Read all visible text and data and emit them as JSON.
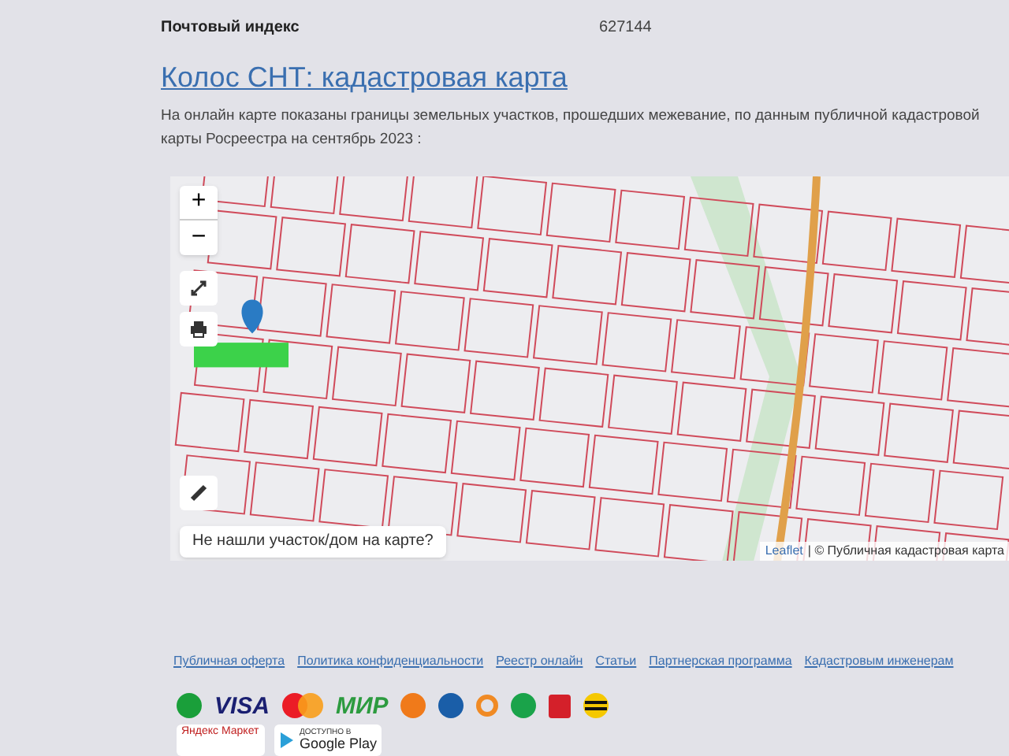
{
  "info_row": {
    "label": "Почтовый индекс",
    "value": "627144"
  },
  "title": "Колос СНТ: кадастровая карта",
  "description": "На онлайн карте показаны границы земельных участков, прошедших межевание, по данным публичной кадастровой карты Росреестра на сентябрь 2023 :",
  "map": {
    "zoom_in": "+",
    "zoom_out": "−",
    "hint": "Не нашли участок/дом на карте?",
    "attribution_link": "Leaflet",
    "attribution": "| © Публичная кадастровая карта"
  },
  "footer_links": [
    "Публичная оферта",
    "Политика конфиденциальности",
    "Реестр онлайн",
    "Статьи",
    "Партнерская программа",
    "Кадастровым инженерам"
  ],
  "payment_logos": [
    {
      "kind": "round",
      "color": "#1a9f3a"
    },
    {
      "kind": "word",
      "label": "VISA",
      "color": "#1a1f71"
    },
    {
      "kind": "circles"
    },
    {
      "kind": "word",
      "label": "МИР",
      "color": "#2c9b3f"
    },
    {
      "kind": "round",
      "color": "#f07a1a"
    },
    {
      "kind": "round",
      "color": "#1a5ea8"
    },
    {
      "kind": "ring",
      "color": "#f08a24"
    },
    {
      "kind": "round",
      "color": "#1aa34a"
    },
    {
      "kind": "square",
      "color": "#d4202a"
    },
    {
      "kind": "stripes"
    }
  ],
  "badges": [
    {
      "kind": "market",
      "label": "Яндекс Маркет"
    },
    {
      "kind": "play",
      "small": "ДОСТУПНО В",
      "label": "Google Play"
    }
  ]
}
